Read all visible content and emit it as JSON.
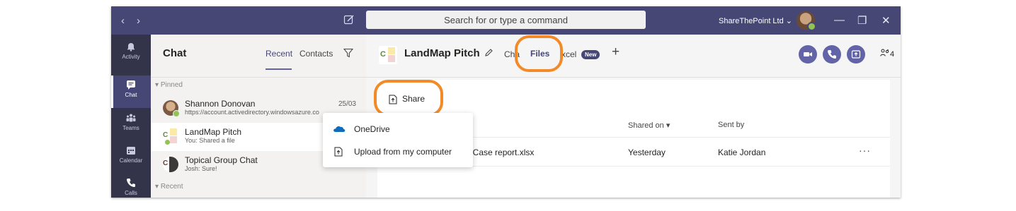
{
  "titlebar": {
    "back": "‹",
    "forward": "›",
    "search_placeholder": "Search for or type a command",
    "tenant": "ShareThePoint Ltd ⌄",
    "minimize": "—",
    "maximize": "❐",
    "close": "✕"
  },
  "rail": {
    "items": [
      {
        "label": "Activity",
        "icon": "bell-icon"
      },
      {
        "label": "Chat",
        "icon": "chat-icon"
      },
      {
        "label": "Teams",
        "icon": "teams-icon"
      },
      {
        "label": "Calendar",
        "icon": "calendar-icon"
      },
      {
        "label": "Calls",
        "icon": "phone-icon"
      }
    ]
  },
  "chatlist": {
    "title": "Chat",
    "tab_recent": "Recent",
    "tab_contacts": "Contacts",
    "pinned_label": "Pinned",
    "recent_label": "Recent",
    "items": [
      {
        "name": "Shannon Donovan",
        "sub": "https://account.activedirectory.windowsazure.co",
        "date": "25/03"
      },
      {
        "name": "LandMap Pitch",
        "sub": "You: Shared a file",
        "date": ""
      },
      {
        "name": "Topical Group Chat",
        "sub": "Josh: Sure!",
        "date": ""
      }
    ]
  },
  "main": {
    "team_initial": "C",
    "channel_name": "LandMap Pitch",
    "tab_chat": "Cha",
    "tab_files": "Files",
    "tab_excel": "xcel",
    "new_badge": "New",
    "add_tab": "+",
    "participant_count": "4",
    "share_label": "Share",
    "columns": {
      "shared_on": "Shared on ▾",
      "sent_by": "Sent by"
    },
    "row": {
      "name": "72 Case report.xlsx",
      "shared_on": "Yesterday",
      "sent_by": "Katie Jordan",
      "more": "···"
    }
  },
  "menu": {
    "items": [
      {
        "label": "OneDrive",
        "icon": "onedrive-icon"
      },
      {
        "label": "Upload from my computer",
        "icon": "upload-icon"
      }
    ]
  },
  "colors": {
    "titlebar": "#464775",
    "rail": "#33344a",
    "accent": "#6264a7",
    "highlight": "#f28b27"
  }
}
